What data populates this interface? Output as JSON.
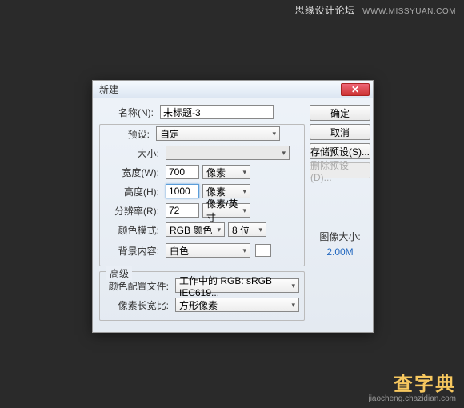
{
  "watermark": {
    "top_text": "思缘设计论坛",
    "top_site": "WWW.MISSYUAN.COM",
    "bottom_big": "查字典",
    "bottom_sub": "jiaocheng.chazidian.com"
  },
  "dialog": {
    "title": "新建",
    "labels": {
      "name": "名称(N):",
      "preset": "预设:",
      "size": "大小:",
      "width": "宽度(W):",
      "height": "高度(H):",
      "resolution": "分辨率(R):",
      "color_mode": "颜色模式:",
      "bg": "背景内容:",
      "advanced": "高级",
      "color_profile": "颜色配置文件:",
      "aspect": "像素长宽比:"
    },
    "values": {
      "name": "未标题-3",
      "preset": "自定",
      "size": "",
      "width": "700",
      "height": "1000",
      "resolution": "72",
      "color_mode": "RGB 颜色",
      "bit_depth": "8 位",
      "bg": "白色",
      "color_profile": "工作中的 RGB: sRGB IEC619...",
      "aspect": "方形像素"
    },
    "units": {
      "width": "像素",
      "height": "像素",
      "resolution": "像素/英寸"
    },
    "buttons": {
      "ok": "确定",
      "cancel": "取消",
      "save_preset": "存储预设(S)...",
      "delete_preset": "删除预设(D)..."
    },
    "image_size": {
      "label": "图像大小:",
      "value": "2.00M"
    }
  }
}
